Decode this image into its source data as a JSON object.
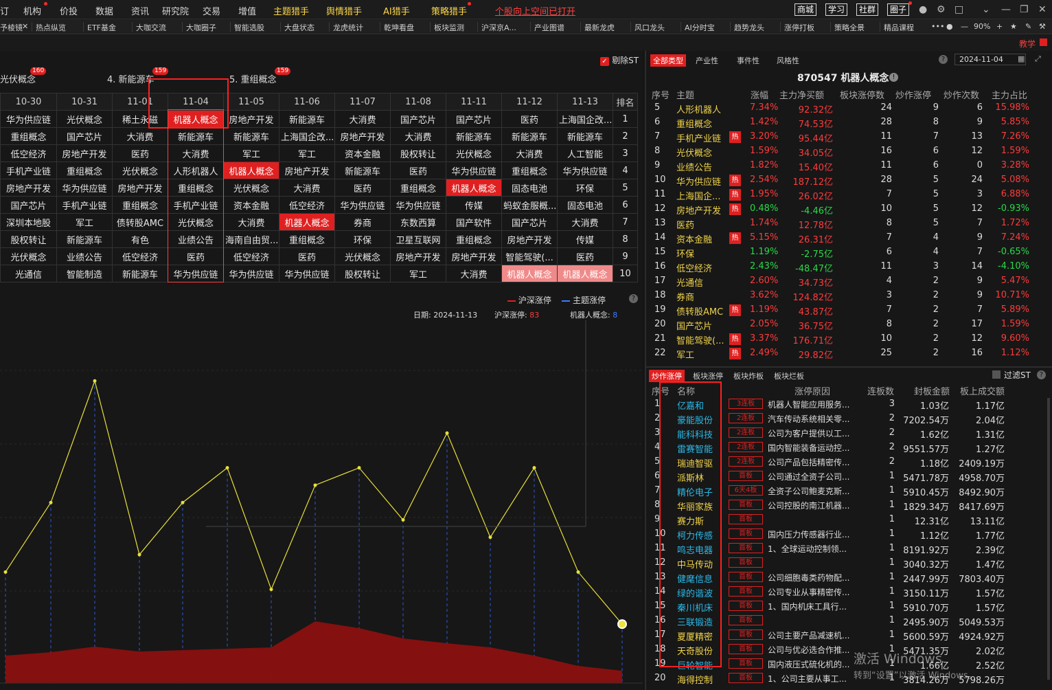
{
  "menubar": {
    "items": [
      "订",
      "机构",
      "价投",
      "数据",
      "资讯",
      "研究院",
      "交易",
      "增值",
      "主题猎手",
      "舆情猎手",
      "AI猎手",
      "策略猎手"
    ],
    "alert": "个股向上空间已打开",
    "buttons": [
      "商城",
      "学习",
      "社群",
      "圈子"
    ]
  },
  "tabbar": {
    "tabs": [
      "予棱镜",
      "热点纵览",
      "ETF基金",
      "大咖交流",
      "大咖圈子",
      "智能选股",
      "大盘状态",
      "龙虎统计",
      "乾坤看盘",
      "板块监测",
      "沪深京A...",
      "产业图谱",
      "最新龙虎",
      "风口龙头",
      "AI分时宝",
      "趋势龙头",
      "涨停打板",
      "策略全景",
      "精品课程"
    ],
    "zoom": "90%"
  },
  "strip": {
    "teach": "教学"
  },
  "left": {
    "filter_label": "剔除ST",
    "concepts": [
      {
        "label": "光伏概念",
        "count": "160"
      },
      {
        "label": "4. 新能源车",
        "count": "159"
      },
      {
        "label": "5. 重组概念",
        "count": "159"
      }
    ],
    "dates": [
      "10-30",
      "10-31",
      "11-01",
      "11-04",
      "11-05",
      "11-06",
      "11-07",
      "11-08",
      "11-11",
      "11-12",
      "11-13"
    ],
    "rank_header": "排名",
    "rows": [
      [
        "华为供应链",
        "光伏概念",
        "稀土永磁",
        "机器人概念",
        "房地产开发",
        "新能源车",
        "大消费",
        "国产芯片",
        "国产芯片",
        "医药",
        "上海国企改...",
        "1"
      ],
      [
        "重组概念",
        "国产芯片",
        "大消费",
        "新能源车",
        "新能源车",
        "上海国企改...",
        "房地产开发",
        "大消费",
        "新能源车",
        "新能源车",
        "新能源车",
        "2"
      ],
      [
        "低空经济",
        "房地产开发",
        "医药",
        "大消费",
        "军工",
        "军工",
        "资本金融",
        "股权转让",
        "光伏概念",
        "大消费",
        "人工智能",
        "3"
      ],
      [
        "手机产业链",
        "重组概念",
        "光伏概念",
        "人形机器人",
        "机器人概念",
        "房地产开发",
        "新能源车",
        "医药",
        "华为供应链",
        "重组概念",
        "华为供应链",
        "4"
      ],
      [
        "房地产开发",
        "华为供应链",
        "房地产开发",
        "重组概念",
        "光伏概念",
        "大消费",
        "医药",
        "重组概念",
        "机器人概念",
        "固态电池",
        "环保",
        "5"
      ],
      [
        "国产芯片",
        "手机产业链",
        "重组概念",
        "手机产业链",
        "资本金融",
        "低空经济",
        "华为供应链",
        "华为供应链",
        "传媒",
        "蚂蚁金服概...",
        "固态电池",
        "6"
      ],
      [
        "深圳本地股",
        "军工",
        "债转股AMC",
        "光伏概念",
        "大消费",
        "机器人概念",
        "券商",
        "东数西算",
        "国产软件",
        "国产芯片",
        "大消费",
        "7"
      ],
      [
        "股权转让",
        "新能源车",
        "有色",
        "业绩公告",
        "海南自由贸...",
        "重组概念",
        "环保",
        "卫星互联网",
        "重组概念",
        "房地产开发",
        "传媒",
        "8"
      ],
      [
        "光伏概念",
        "业绩公告",
        "低空经济",
        "医药",
        "低空经济",
        "医药",
        "光伏概念",
        "房地产开发",
        "房地产开发",
        "智能驾驶(...",
        "医药",
        "9"
      ],
      [
        "光通信",
        "智能制造",
        "新能源车",
        "华为供应链",
        "华为供应链",
        "华为供应链",
        "股权转让",
        "军工",
        "大消费",
        "机器人概念",
        "机器人概念",
        "10"
      ]
    ],
    "legend": {
      "a": "沪深涨停",
      "b": "主题涨停"
    },
    "info": {
      "date_label": "日期:",
      "date": "2024-11-13",
      "hs_label": "沪深涨停:",
      "hs": "83",
      "topic_label": "机器人概念:",
      "topic": "8"
    }
  },
  "chart_data": {
    "type": "line",
    "series": [
      {
        "name": "主题涨停",
        "values": [
          6,
          10,
          17,
          7,
          10,
          12,
          5,
          11,
          12,
          9,
          14,
          8,
          12,
          6,
          3
        ]
      },
      {
        "name": "沪深涨停",
        "values": [
          40,
          45,
          53,
          46,
          48,
          50,
          52,
          90,
          80,
          65,
          58,
          52,
          40,
          25,
          18
        ]
      }
    ],
    "colors": {
      "line": "#e8e03a",
      "area": "#8a1010",
      "grid": "#2d5bd8"
    }
  },
  "right": {
    "tabs": [
      "全部类型",
      "产业性",
      "事件性",
      "风格性"
    ],
    "date": "2024-11-04",
    "title": "870547 机器人概念",
    "headers": [
      "序号",
      "主题",
      "涨幅",
      "主力净买额",
      "板块涨停数",
      "炒作涨停",
      "炒作次数",
      "主力占比"
    ],
    "rows": [
      [
        "5",
        "人形机器人",
        "7.34%",
        "92.32亿",
        "24",
        "9",
        "6",
        "15.98%",
        "",
        "r"
      ],
      [
        "6",
        "重组概念",
        "1.42%",
        "74.53亿",
        "28",
        "8",
        "9",
        "5.85%",
        "",
        "r"
      ],
      [
        "7",
        "手机产业链",
        "3.20%",
        "95.44亿",
        "11",
        "7",
        "13",
        "7.26%",
        "热",
        "r"
      ],
      [
        "8",
        "光伏概念",
        "1.59%",
        "34.05亿",
        "16",
        "6",
        "12",
        "1.59%",
        "",
        "r"
      ],
      [
        "9",
        "业绩公告",
        "1.82%",
        "15.40亿",
        "11",
        "6",
        "0",
        "3.28%",
        "",
        "r"
      ],
      [
        "10",
        "华为供应链",
        "2.54%",
        "187.12亿",
        "28",
        "5",
        "24",
        "5.08%",
        "热",
        "r"
      ],
      [
        "11",
        "上海国企...",
        "1.95%",
        "26.02亿",
        "7",
        "5",
        "3",
        "6.88%",
        "热",
        "r"
      ],
      [
        "12",
        "房地产开发",
        "0.48%",
        "-4.46亿",
        "10",
        "5",
        "12",
        "-0.93%",
        "热",
        "g"
      ],
      [
        "13",
        "医药",
        "1.74%",
        "12.78亿",
        "8",
        "5",
        "7",
        "1.72%",
        "",
        "r"
      ],
      [
        "14",
        "资本金融",
        "5.15%",
        "26.31亿",
        "7",
        "4",
        "9",
        "7.24%",
        "热",
        "r"
      ],
      [
        "15",
        "环保",
        "1.19%",
        "-2.75亿",
        "6",
        "4",
        "7",
        "-0.65%",
        "",
        "g"
      ],
      [
        "16",
        "低空经济",
        "2.43%",
        "-48.47亿",
        "11",
        "3",
        "14",
        "-4.10%",
        "",
        "g"
      ],
      [
        "17",
        "光通信",
        "2.60%",
        "34.73亿",
        "4",
        "2",
        "9",
        "5.47%",
        "",
        "r"
      ],
      [
        "18",
        "券商",
        "3.62%",
        "124.82亿",
        "3",
        "2",
        "9",
        "10.71%",
        "",
        "r"
      ],
      [
        "19",
        "债转股AMC",
        "1.19%",
        "43.87亿",
        "7",
        "2",
        "7",
        "5.89%",
        "热",
        "r"
      ],
      [
        "20",
        "国产芯片",
        "2.05%",
        "36.75亿",
        "8",
        "2",
        "17",
        "1.59%",
        "",
        "r"
      ],
      [
        "21",
        "智能驾驶(...",
        "3.37%",
        "176.71亿",
        "10",
        "2",
        "12",
        "9.60%",
        "热",
        "r"
      ],
      [
        "22",
        "军工",
        "2.49%",
        "29.82亿",
        "25",
        "2",
        "16",
        "1.12%",
        "热",
        "r"
      ]
    ],
    "bottom_tabs": [
      "炒作涨停",
      "板块涨停",
      "板块炸板",
      "板块烂板"
    ],
    "filter_label": "过滤ST",
    "stock_headers": [
      "序号",
      "名称",
      "涨停原因",
      "连板数",
      "封板金额",
      "板上成交额"
    ],
    "stocks": [
      [
        "1",
        "亿嘉和",
        "3连板",
        "机器人智能应用服务...",
        "3",
        "1.03亿",
        "1.17亿"
      ],
      [
        "2",
        "豪能股份",
        "2连板",
        "汽车传动系统相关零...",
        "2",
        "7202.54万",
        "2.04亿"
      ],
      [
        "3",
        "能科科技",
        "2连板",
        "公司为客户提供以工...",
        "2",
        "1.62亿",
        "1.31亿"
      ],
      [
        "4",
        "雷赛智能",
        "2连板",
        "国内智能装备运动控...",
        "2",
        "9551.57万",
        "1.27亿"
      ],
      [
        "5",
        "瑞迪智驱",
        "2连板",
        "公司产品包括精密传...",
        "2",
        "1.18亿",
        "2409.19万"
      ],
      [
        "6",
        "派斯林",
        "首板",
        "公司通过全资子公司...",
        "1",
        "5471.78万",
        "4958.70万"
      ],
      [
        "7",
        "精伦电子",
        "6天4板",
        "全资子公司鲍麦克斯...",
        "1",
        "5910.45万",
        "8492.90万"
      ],
      [
        "8",
        "华丽家族",
        "首板",
        "公司控股的南江机器...",
        "1",
        "1829.34万",
        "8417.69万"
      ],
      [
        "9",
        "赛力斯",
        "首板",
        "",
        "1",
        "12.31亿",
        "13.11亿"
      ],
      [
        "10",
        "柯力传感",
        "首板",
        "国内压力传感器行业...",
        "1",
        "1.12亿",
        "1.77亿"
      ],
      [
        "11",
        "鸣志电器",
        "首板",
        "1、全球运动控制领...",
        "1",
        "8191.92万",
        "2.39亿"
      ],
      [
        "12",
        "中马传动",
        "首板",
        "",
        "1",
        "3040.32万",
        "1.47亿"
      ],
      [
        "13",
        "健麾信息",
        "首板",
        "公司细胞毒类药物配...",
        "1",
        "2447.99万",
        "7803.40万"
      ],
      [
        "14",
        "绿的谐波",
        "首板",
        "公司专业从事精密传...",
        "1",
        "3150.11万",
        "1.57亿"
      ],
      [
        "15",
        "秦川机床",
        "首板",
        "1、国内机床工具行...",
        "1",
        "5910.70万",
        "1.57亿"
      ],
      [
        "16",
        "三联锻造",
        "首板",
        "",
        "1",
        "2495.90万",
        "5049.53万"
      ],
      [
        "17",
        "夏厦精密",
        "首板",
        "公司主要产品减速机...",
        "1",
        "5600.59万",
        "4924.92万"
      ],
      [
        "18",
        "天奇股份",
        "首板",
        "公司与优必选合作推...",
        "1",
        "5471.35万",
        "2.02亿"
      ],
      [
        "19",
        "巨轮智能",
        "首板",
        "国内液压式硫化机的...",
        "1",
        "1.66亿",
        "2.52亿"
      ],
      [
        "20",
        "海得控制",
        "首板",
        "1、公司主要从事工...",
        "1",
        "3814.26万",
        "5798.26万"
      ]
    ],
    "watermark": {
      "line1": "激活 Windows",
      "line2": "转到“设置”以激活 Windows。"
    }
  }
}
